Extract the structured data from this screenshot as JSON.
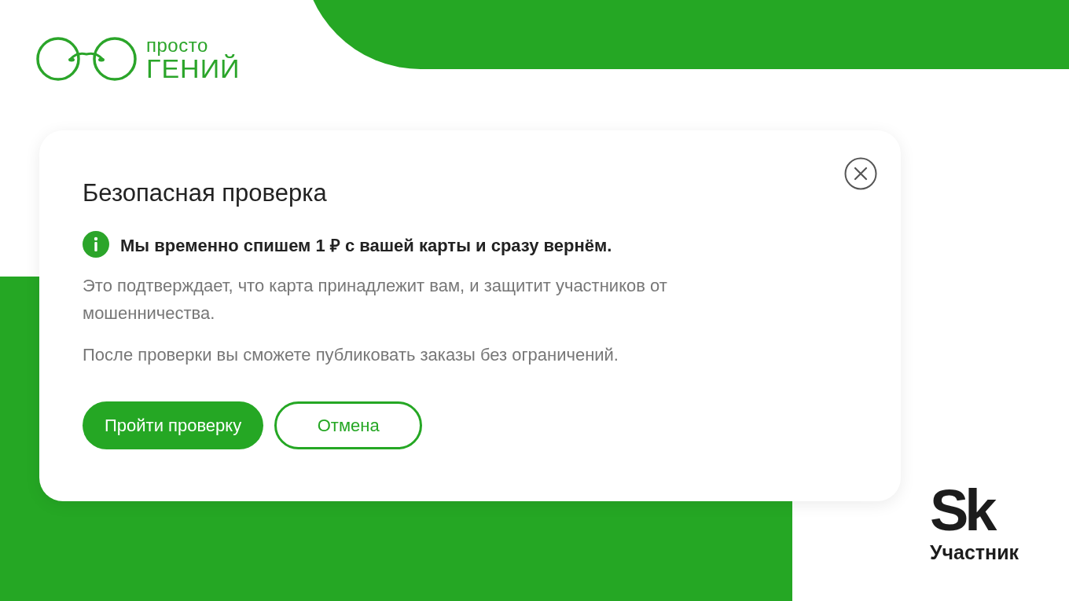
{
  "logo": {
    "line1": "просто",
    "line2": "ГЕНИЙ"
  },
  "dialog": {
    "title": "Безопасная проверка",
    "notice": "Мы временно спишем 1 ₽ с вашей карты и сразу вернём.",
    "paragraphs": [
      "Это подтверждает, что карта принадлежит вам, и защитит участников от мошенничества.",
      "После проверки вы сможете публиковать заказы без ограничений."
    ],
    "buttons": [
      {
        "label": "Пройти проверку",
        "kind": "primary"
      },
      {
        "label": "Отмена",
        "kind": "secondary"
      }
    ]
  },
  "partner_badge": {
    "mark": "Sk",
    "caption": "Участник"
  }
}
